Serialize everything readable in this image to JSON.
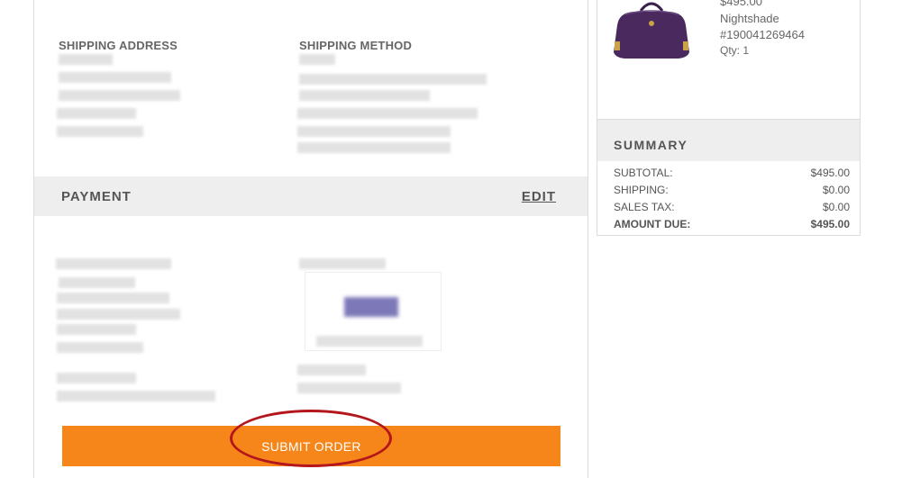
{
  "shipping": {
    "address_label": "SHIPPING ADDRESS",
    "method_label": "SHIPPING METHOD"
  },
  "payment": {
    "title": "PAYMENT",
    "edit_label": "EDIT"
  },
  "submit": {
    "label": "SUBMIT ORDER"
  },
  "item": {
    "price": "$495.00",
    "color": "Nightshade",
    "sku": "#190041269464",
    "qty": "Qty: 1"
  },
  "summary": {
    "title": "SUMMARY",
    "rows": [
      {
        "label": "SUBTOTAL:",
        "value": "$495.00"
      },
      {
        "label": "SHIPPING:",
        "value": "$0.00"
      },
      {
        "label": "SALES TAX:",
        "value": "$0.00"
      },
      {
        "label": "AMOUNT DUE:",
        "value": "$495.00"
      }
    ]
  },
  "colors": {
    "button": "#f7861a",
    "highlight": "#b3161b",
    "bag": "#4a2a5e"
  }
}
